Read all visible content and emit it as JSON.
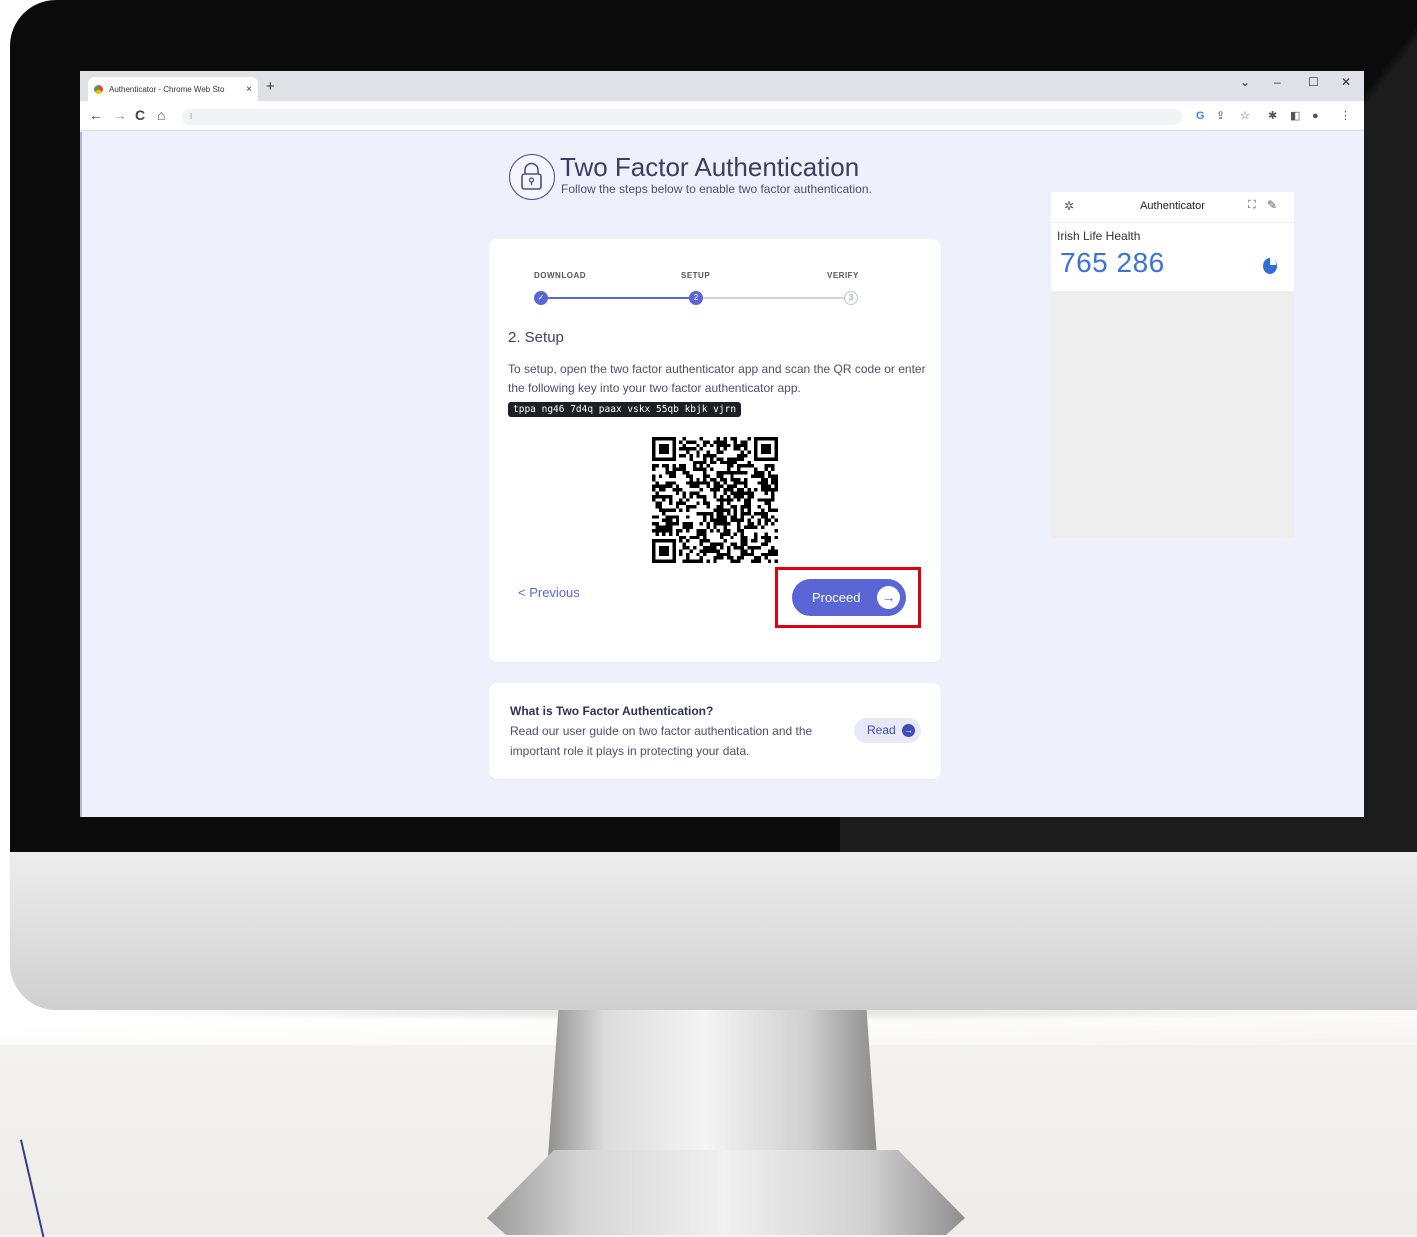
{
  "browser": {
    "tab_title": "Authenticator - Chrome Web Sto",
    "tab_close": "×",
    "new_tab": "+",
    "window_controls": {
      "collapse": "⌄",
      "minimize": "–",
      "maximize": "☐",
      "close": "✕"
    },
    "nav": {
      "back": "←",
      "forward": "→",
      "reload": "C",
      "home": "⌂"
    },
    "omnibox_text": "I"
  },
  "page": {
    "title": "Two Factor Authentication",
    "subtitle": "Follow the steps below to enable two factor authentication.",
    "steps": [
      {
        "label": "DOWNLOAD",
        "marker": "✓",
        "state": "done"
      },
      {
        "label": "SETUP",
        "marker": "2",
        "state": "active"
      },
      {
        "label": "VERIFY",
        "marker": "3",
        "state": "todo"
      }
    ],
    "setup_heading": "2. Setup",
    "setup_text": "To setup, open the two factor authenticator app and scan the QR code or enter the following key into your two factor authenticator app.",
    "secret_key": "tppa ng46 7d4q paax vskx 55qb kbjk vjrn",
    "previous_label": "< Previous",
    "proceed_label": "Proceed",
    "proceed_icon": "→",
    "info_heading": "What is Two Factor Authentication?",
    "info_text": "Read our user guide on two factor authentication and the important role it plays in protecting your data.",
    "read_label": "Read",
    "read_icon": "→"
  },
  "authenticator": {
    "title": "Authenticator",
    "issuer": "Irish Life Health",
    "code": "765 286"
  },
  "colors": {
    "accent": "#5a66d6",
    "highlight": "#e1000f",
    "page_bg": "#eef0fb",
    "code_blue": "#3c72d8"
  }
}
